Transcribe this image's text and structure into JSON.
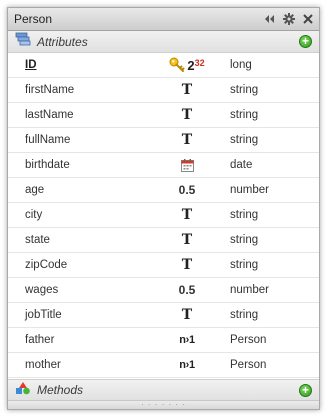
{
  "window": {
    "title": "Person"
  },
  "sections": {
    "attributes_label": "Attributes",
    "methods_label": "Methods"
  },
  "id_row": {
    "name": "ID",
    "icon_text": "2",
    "icon_sup": "32",
    "type": "long"
  },
  "attributes": [
    {
      "name": "firstName",
      "kind": "text",
      "icon_text": "T",
      "type": "string"
    },
    {
      "name": "lastName",
      "kind": "text",
      "icon_text": "T",
      "type": "string"
    },
    {
      "name": "fullName",
      "kind": "text",
      "icon_text": "T",
      "type": "string"
    },
    {
      "name": "birthdate",
      "kind": "date",
      "icon_text": "",
      "type": "date"
    },
    {
      "name": "age",
      "kind": "number",
      "icon_text": "0.5",
      "type": "number"
    },
    {
      "name": "city",
      "kind": "text",
      "icon_text": "T",
      "type": "string"
    },
    {
      "name": "state",
      "kind": "text",
      "icon_text": "T",
      "type": "string"
    },
    {
      "name": "zipCode",
      "kind": "text",
      "icon_text": "T",
      "type": "string"
    },
    {
      "name": "wages",
      "kind": "number",
      "icon_text": "0.5",
      "type": "number"
    },
    {
      "name": "jobTitle",
      "kind": "text",
      "icon_text": "T",
      "type": "string"
    },
    {
      "name": "father",
      "kind": "relation",
      "icon_text": "n›1",
      "type": "Person"
    },
    {
      "name": "mother",
      "kind": "relation",
      "icon_text": "n›1",
      "type": "Person"
    }
  ],
  "icons": {
    "collapse": "double-arrow-left-icon",
    "settings": "gear-icon",
    "close": "close-icon",
    "attributes": "stack-icon",
    "methods": "shapes-icon",
    "add": "plus-circle-icon",
    "key": "key-icon",
    "calendar": "calendar-icon"
  },
  "colors": {
    "add_green": "#2e9d1a",
    "key_gold": "#e8b100",
    "sup_red": "#d03020",
    "calendar_red": "#d03a2a"
  }
}
